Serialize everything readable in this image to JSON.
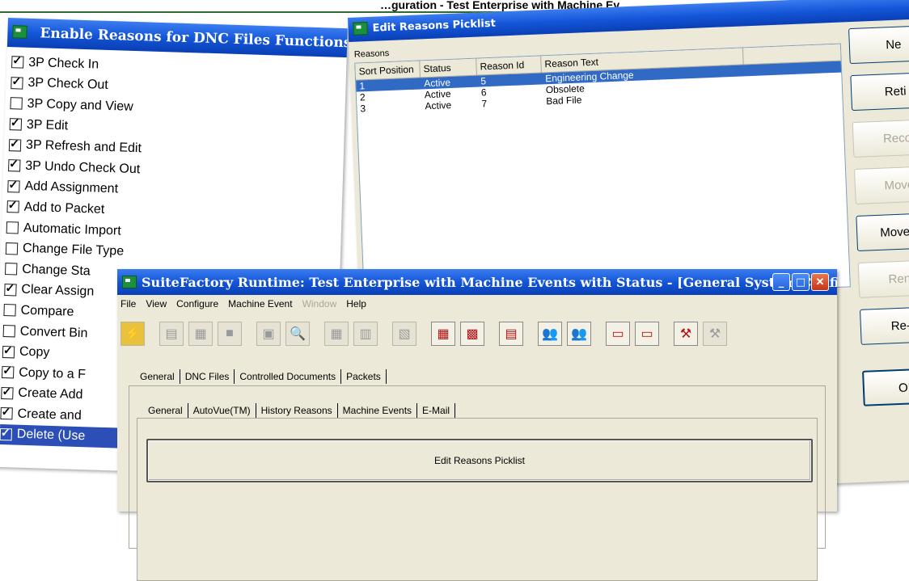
{
  "top_title": "…guration - Test Enterprise with Machine Ev…",
  "enable_window": {
    "title": "Enable Reasons for DNC Files Functions",
    "items": [
      {
        "label": "3P Check In",
        "checked": true
      },
      {
        "label": "3P Check Out",
        "checked": true
      },
      {
        "label": "3P Copy and View",
        "checked": false
      },
      {
        "label": "3P Edit",
        "checked": true
      },
      {
        "label": "3P Refresh and Edit",
        "checked": true
      },
      {
        "label": "3P Undo Check Out",
        "checked": true
      },
      {
        "label": "Add Assignment",
        "checked": true
      },
      {
        "label": "Add to Packet",
        "checked": true
      },
      {
        "label": "Automatic Import",
        "checked": false
      },
      {
        "label": "Change File Type",
        "checked": false
      },
      {
        "label": "Change Sta",
        "checked": false
      },
      {
        "label": "Clear Assign",
        "checked": true
      },
      {
        "label": "Compare",
        "checked": false
      },
      {
        "label": "Convert Bin",
        "checked": false
      },
      {
        "label": "Copy",
        "checked": true
      },
      {
        "label": "Copy to a F",
        "checked": true
      },
      {
        "label": "Create Add",
        "checked": true
      },
      {
        "label": "Create and",
        "checked": true
      },
      {
        "label": "Delete (Use",
        "checked": true,
        "selected": true
      }
    ]
  },
  "picklist_window": {
    "title": "Edit Reasons Picklist",
    "reasons_label": "Reasons",
    "columns": [
      "Sort Position",
      "Status",
      "Reason Id",
      "Reason Text"
    ],
    "rows": [
      {
        "sort": "1",
        "status": "Active",
        "id": "5",
        "text": "Engineering Change",
        "selected": true
      },
      {
        "sort": "2",
        "status": "Active",
        "id": "6",
        "text": "Obsolete",
        "selected": false
      },
      {
        "sort": "3",
        "status": "Active",
        "id": "7",
        "text": "Bad File",
        "selected": false
      }
    ],
    "buttons": {
      "new": "Ne",
      "retire": "Reti",
      "reco": "Reco",
      "move_up": "Move",
      "move_down": "Move D",
      "renum": "Renu",
      "resort": "Re-S",
      "ok": "OK"
    }
  },
  "runtime_window": {
    "title": "SuiteFactory Runtime: Test Enterprise with Machine Events with Status - [General System Configu...",
    "menu": [
      "File",
      "View",
      "Configure",
      "Machine Event",
      "Window",
      "Help"
    ],
    "tabs_top": [
      "General",
      "DNC Files",
      "Controlled Documents",
      "Packets"
    ],
    "tabs_sub": [
      "General",
      "AutoVue(TM)",
      "History Reasons",
      "Machine Events",
      "E-Mail"
    ],
    "edit_button": "Edit Reasons Picklist"
  },
  "colors": {
    "titlebar": "#1456d8",
    "selection": "#316ac5",
    "window_bg": "#ece9d8"
  }
}
